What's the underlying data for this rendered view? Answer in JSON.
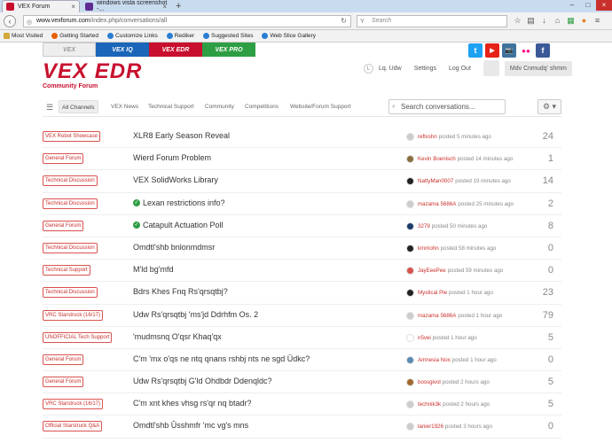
{
  "browser": {
    "tabs": [
      {
        "label": "VEX Forum",
        "close": "×"
      },
      {
        "label": "windows vista screenshot -...",
        "close": "×"
      }
    ],
    "new_tab": "+",
    "url_domain": "www.vexforum.com",
    "url_path": "/index.php/conversations/all",
    "search_placeholder": "Search",
    "bookmarks": [
      "Most Visited",
      "Getting Started",
      "Customize Links",
      "Rediker",
      "Suggested Sites",
      "Web Slice Gallery"
    ]
  },
  "site": {
    "nav_tabs": [
      "VEX",
      "VEX IQ",
      "VEX EDR",
      "VEX PRO"
    ],
    "logo_text": "VEX EDR",
    "logo_sub": "Community Forum",
    "social": [
      "t",
      "▶",
      "📷",
      "●●",
      "f"
    ]
  },
  "user": {
    "avatar_letter": "L",
    "name": "Lq. Udw",
    "settings": "Settings",
    "logout": "Log Out",
    "profile_button": "Mdv Cnmudq' shmm"
  },
  "channels": {
    "items": [
      "All Channels",
      "VEX News",
      "Technical Support",
      "Community",
      "Competitions",
      "Website/Forum Support"
    ],
    "search_placeholder": "Search conversations..."
  },
  "conversations": [
    {
      "cat": "VEX Robot Showcase",
      "title": "XLR8 Early Season Reveal",
      "solved": false,
      "user": "reflxshn",
      "time": "posted 5 minutes ago",
      "count": "24",
      "avatar": "#ccc"
    },
    {
      "cat": "General Forum",
      "title": "Wierd Forum Problem",
      "solved": false,
      "user": "Kevin Boenisch",
      "time": "posted 14 minutes ago",
      "count": "1",
      "avatar": "#8a6d3b"
    },
    {
      "cat": "Technical Discussion",
      "title": "VEX SolidWorks Library",
      "solved": false,
      "user": "NattyMan0007",
      "time": "posted 19 minutes ago",
      "count": "14",
      "avatar": "#222"
    },
    {
      "cat": "Technical Discussion",
      "title": "Lexan restrictions info?",
      "solved": true,
      "user": "mazama 5686A",
      "time": "posted 25 minutes ago",
      "count": "2",
      "avatar": "#ccc"
    },
    {
      "cat": "General Forum",
      "title": "Catapult Actuation Poll",
      "solved": true,
      "user": "3279",
      "time": "posted 50 minutes ago",
      "count": "8",
      "avatar": "#1b3c6b"
    },
    {
      "cat": "Technical Discussion",
      "title": "Omdtl'shb bnlonmdmsr",
      "solved": false,
      "user": "kmmohn",
      "time": "posted 58 minutes ago",
      "count": "0",
      "avatar": "#222"
    },
    {
      "cat": "Technical Support",
      "title": "M'ld bg'mfd",
      "solved": false,
      "user": "JayEeePee",
      "time": "posted 59 minutes ago",
      "count": "0",
      "avatar": "#d9534f"
    },
    {
      "cat": "Technical Discussion",
      "title": "Bdrs Khes Fnq Rs'qrsqtbj?",
      "solved": false,
      "user": "Mystical Pie",
      "time": "posted 1 hour ago",
      "count": "23",
      "avatar": "#222"
    },
    {
      "cat": "VRC Starstruck (16/17)",
      "title": "Udw Rs'qrsqtbj 'ms'jd Ddrhfm Os. 2",
      "solved": false,
      "user": "mazama 5686A",
      "time": "posted 1 hour ago",
      "count": "79",
      "avatar": "#ccc"
    },
    {
      "cat": "UNOFFICIAL Tech Support",
      "title": "'mudmsnq O'qsr Khaq'qx",
      "solved": false,
      "user": "n5vei",
      "time": "posted 1 hour ago",
      "count": "5",
      "avatar": "#fff"
    },
    {
      "cat": "General Forum",
      "title": "C'm 'mx o'qs ne ntq qnans rshbj nts ne sgd Üdkc?",
      "solved": false,
      "user": "Amnesia Nox",
      "time": "posted 1 hour ago",
      "count": "0",
      "avatar": "#5b8bb5"
    },
    {
      "cat": "General Forum",
      "title": "Udw Rs'qrsqtbj G'ld Ohdbdr Ddenqldc?",
      "solved": false,
      "user": "bossgivol",
      "time": "posted 2 hours ago",
      "count": "5",
      "avatar": "#a06a2c"
    },
    {
      "cat": "VRC Starstruck (16/17)",
      "title": "C'm xnt khes vhsg rs'qr nq btadr?",
      "solved": false,
      "user": "technik3k",
      "time": "posted 2 hours ago",
      "count": "5",
      "avatar": "#ccc"
    },
    {
      "cat": "Official Starstruck Q&A",
      "title": "Omdtl'shb Ûsshmfr 'mc vg's mns",
      "solved": false,
      "user": "lanier1926",
      "time": "posted 3 hours ago",
      "count": "0",
      "avatar": "#ccc"
    }
  ]
}
